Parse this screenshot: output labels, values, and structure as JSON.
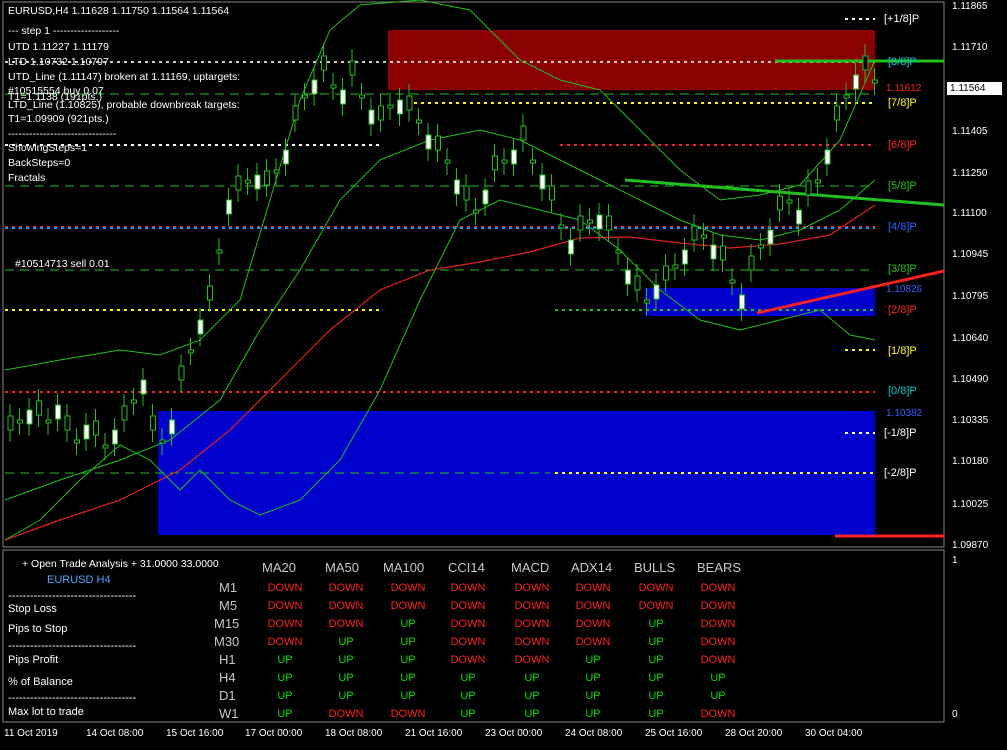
{
  "header": {
    "symbol_line": "EURUSD,H4  1.11628 1.11750 1.11564 1.11564",
    "step_line": "---  step 1  -------------------",
    "utd_line": "UTD 1.11227  1.11179",
    "ltd_line": "LTD 1.10732  1.10797",
    "utd_broken": "UTD_Line (1.11147) broken at 1.11169, uptargets:",
    "overlap_a": "#10515554 buy 0.07",
    "overlap_b": "T1=1.1138 (191pts.)",
    "ltd_probable": "LTD_Line (1.10825), probable downbreak targets:",
    "t1_line": "T1=1.09909 (921pts.)",
    "sep_line": "-------------------------------",
    "showing_steps": "ShowingSteps=1",
    "back_steps": "BackSteps=0",
    "fractals": "Fractals",
    "sell_order": "#10514713 sell 0.01"
  },
  "price_axis": {
    "ticks": [
      "1.11865",
      "1.11710",
      "1.11555",
      "1.11405",
      "1.11250",
      "1.11100",
      "1.10945",
      "1.10795",
      "1.10640",
      "1.10490",
      "1.10335",
      "1.10180",
      "1.10025",
      "1.09870"
    ],
    "current_price": "1.11564",
    "indicator_max": "1",
    "indicator_min": "0"
  },
  "time_axis": {
    "labels": [
      "11 Oct 2019",
      "14 Oct 08:00",
      "15 Oct 16:00",
      "17 Oct 00:00",
      "18 Oct 08:00",
      "21 Oct 16:00",
      "23 Oct 00:00",
      "24 Oct 08:00",
      "25 Oct 16:00",
      "28 Oct 20:00",
      "30 Oct 04:00"
    ]
  },
  "murrey": [
    {
      "label": "[+1/8]P",
      "color": "#ffffff"
    },
    {
      "label": "[8/8]P",
      "color": "#00c8c8"
    },
    {
      "label": "[7/8]P",
      "color": "#ffff00"
    },
    {
      "label": "[6/8]P",
      "color": "#ff2020"
    },
    {
      "label": "[5/8]P",
      "color": "#20c020"
    },
    {
      "label": "[4/8]P",
      "color": "#3060ff"
    },
    {
      "label": "[3/8]P",
      "color": "#20c020"
    },
    {
      "label": "[2/8]P",
      "color": "#ff2020"
    },
    {
      "label": "[1/8]P",
      "color": "#ffff00"
    },
    {
      "label": "[0/8]P",
      "color": "#00c8c8"
    },
    {
      "label": "[-1/8]P",
      "color": "#ffffff"
    },
    {
      "label": "[-2/8]P",
      "color": "#ffffff"
    }
  ],
  "box_labels": {
    "red_box_price": "1.11612",
    "blue_box_price": "1.10826",
    "lower_box_price": "1.10382"
  },
  "trade_panel": {
    "title": "+ Open Trade Analysis + 31.0000 33.0000",
    "symbol": "EURUSD  H4",
    "dashes": "-----------------------------------",
    "rows": [
      "Stop Loss",
      "Pips to Stop",
      "Pips Profit",
      "% of Balance",
      "Max lot to trade"
    ]
  },
  "signals": {
    "columns": [
      "MA20",
      "MA50",
      "MA100",
      "CCI14",
      "MACD",
      "ADX14",
      "BULLS",
      "BEARS"
    ],
    "timeframes": [
      "M1",
      "M5",
      "M15",
      "M30",
      "H1",
      "H4",
      "D1",
      "W1"
    ],
    "up_color": "#00e000",
    "down_color": "#ff2020",
    "values": [
      [
        "DOWN",
        "DOWN",
        "DOWN",
        "DOWN",
        "DOWN",
        "DOWN",
        "DOWN",
        "DOWN"
      ],
      [
        "DOWN",
        "DOWN",
        "DOWN",
        "DOWN",
        "DOWN",
        "DOWN",
        "DOWN",
        "DOWN"
      ],
      [
        "DOWN",
        "DOWN",
        "UP",
        "DOWN",
        "DOWN",
        "DOWN",
        "UP",
        "DOWN"
      ],
      [
        "DOWN",
        "UP",
        "UP",
        "DOWN",
        "DOWN",
        "DOWN",
        "UP",
        "DOWN"
      ],
      [
        "UP",
        "UP",
        "UP",
        "DOWN",
        "DOWN",
        "UP",
        "UP",
        "DOWN"
      ],
      [
        "UP",
        "UP",
        "UP",
        "UP",
        "UP",
        "UP",
        "UP",
        "UP"
      ],
      [
        "UP",
        "UP",
        "UP",
        "UP",
        "UP",
        "UP",
        "UP",
        "UP"
      ],
      [
        "UP",
        "DOWN",
        "DOWN",
        "UP",
        "UP",
        "UP",
        "UP",
        "DOWN"
      ]
    ]
  }
}
